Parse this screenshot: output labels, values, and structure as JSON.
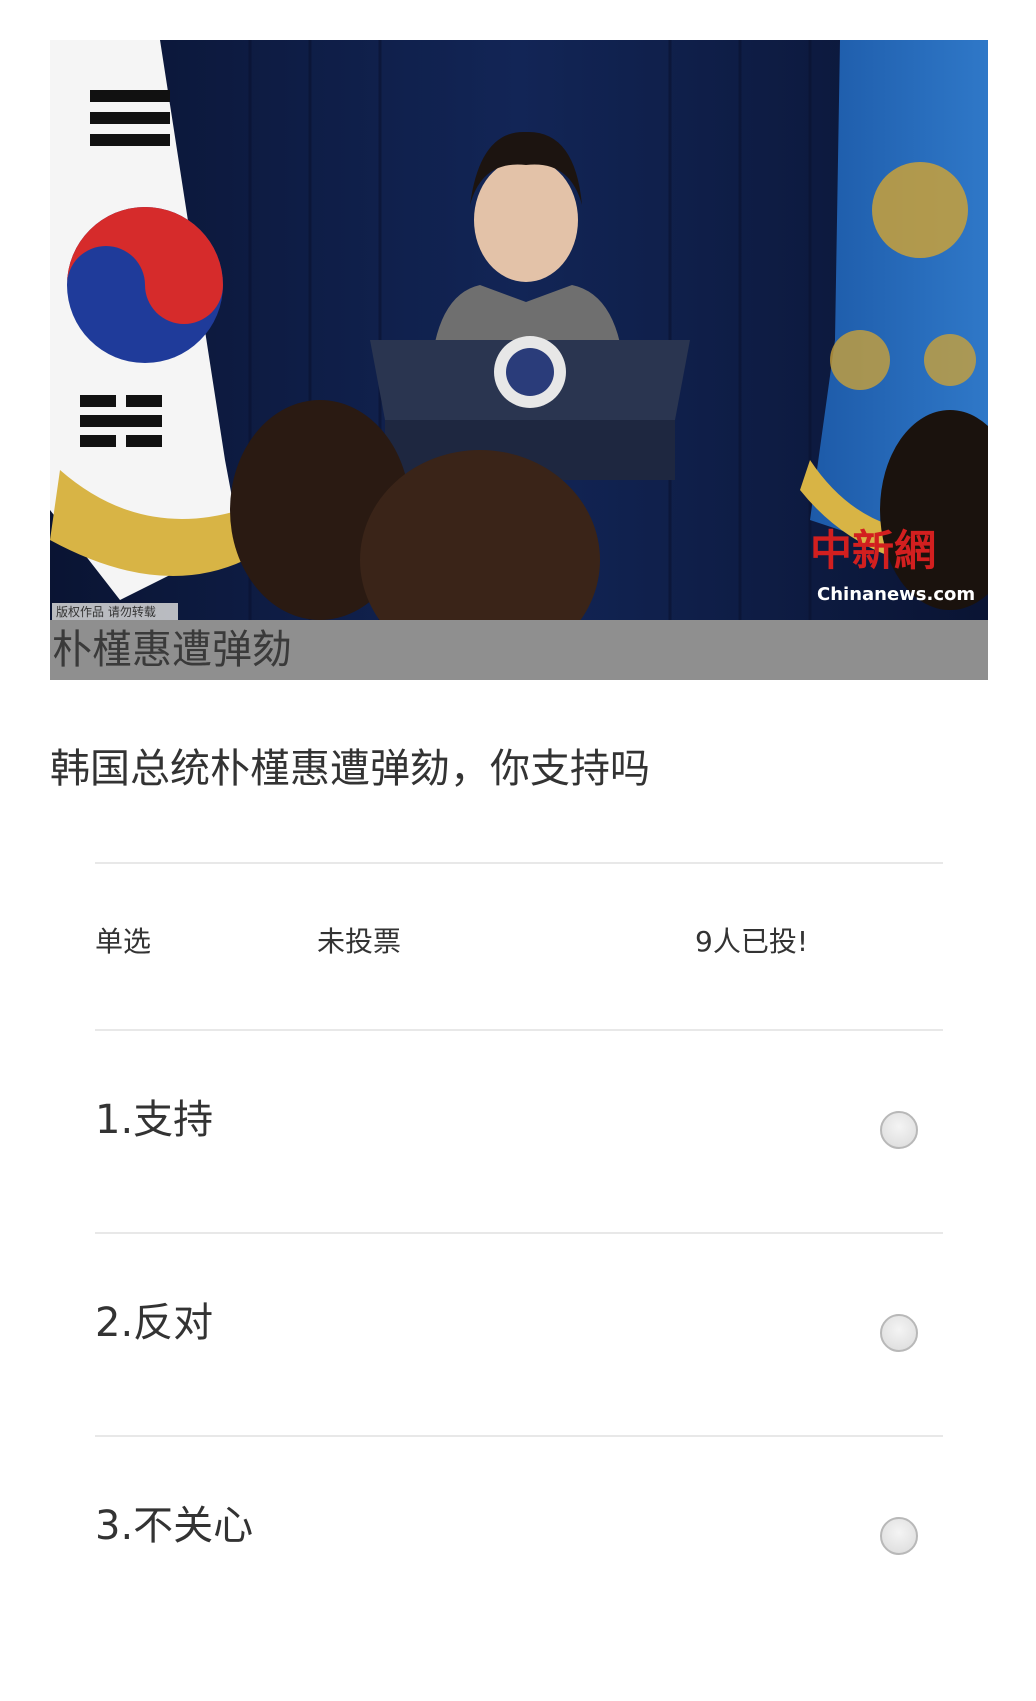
{
  "banner": {
    "watermark_left": "版权作品 请勿转载",
    "logo_cn": "中新網",
    "logo_en": "Chinanews.com",
    "caption": "朴槿惠遭弹劾"
  },
  "question": "韩国总统朴槿惠遭弹劾，你支持吗",
  "meta": {
    "type": "单选",
    "status": "未投票",
    "count": "9人已投!"
  },
  "options": [
    {
      "label": "1.支持"
    },
    {
      "label": "2.反对"
    },
    {
      "label": "3.不关心"
    }
  ],
  "colors": {
    "caption_bg": "#8f8f8f",
    "divider": "#e8e8e8",
    "curtain": "#0e1a3c"
  }
}
